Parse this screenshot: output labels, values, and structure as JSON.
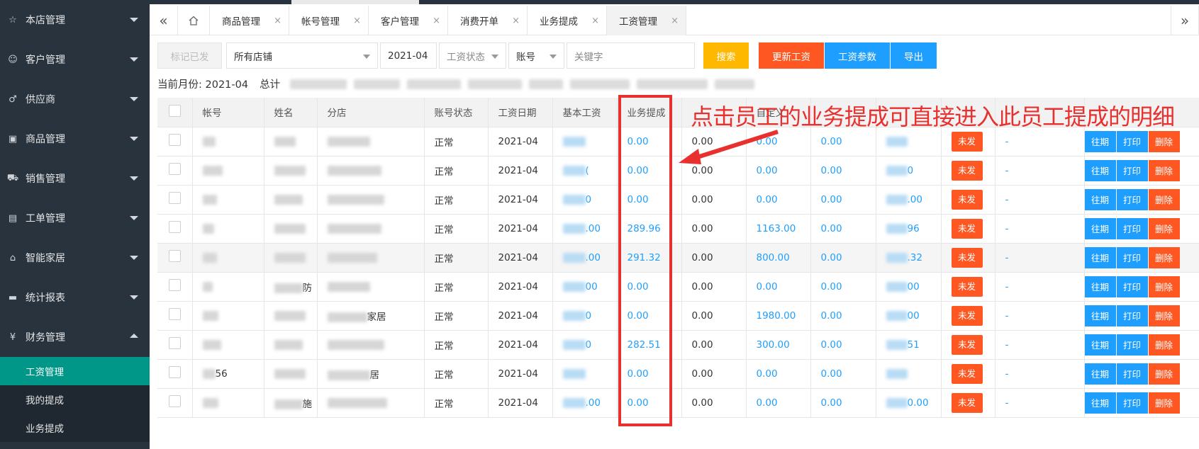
{
  "sidebar": {
    "items": [
      {
        "label": "本店管理",
        "icon": "star-icon"
      },
      {
        "label": "客户管理",
        "icon": "user-icon"
      },
      {
        "label": "供应商",
        "icon": "male-icon"
      },
      {
        "label": "商品管理",
        "icon": "gift-icon"
      },
      {
        "label": "销售管理",
        "icon": "cart-icon"
      },
      {
        "label": "工单管理",
        "icon": "clipboard-icon"
      },
      {
        "label": "智能家居",
        "icon": "home-icon"
      },
      {
        "label": "统计报表",
        "icon": "chart-icon"
      },
      {
        "label": "财务管理",
        "icon": "yen-icon"
      }
    ],
    "sub_items": [
      "工资管理",
      "我的提成",
      "业务提成"
    ],
    "active_sub": "工资管理",
    "active_color": "#009688"
  },
  "tabs": [
    "商品管理",
    "帐号管理",
    "客户管理",
    "消费开单",
    "业务提成",
    "工资管理"
  ],
  "active_tab": "工资管理",
  "toolbar": {
    "mark_paid": "标记已发",
    "store_select": "所有店铺",
    "month": "2021-04",
    "salary_status": "工资状态",
    "account": "账号",
    "keyword_placeholder": "关键字",
    "search": "搜索",
    "update_salary": "更新工资",
    "salary_params": "工资参数",
    "export": "导出",
    "colors": {
      "search": "#ffb800",
      "update": "#ff5722",
      "params": "#1e9fff"
    }
  },
  "summary": {
    "month_label": "当前月份: 2021-04",
    "total_label": "总计"
  },
  "table": {
    "headers": [
      "帐号",
      "姓名",
      "分店",
      "账号状态",
      "工资日期",
      "基本工资",
      "业务提成",
      "",
      "自定义",
      "",
      "",
      "",
      ""
    ],
    "rows": [
      {
        "account": "",
        "name": "",
        "store": "",
        "status": "正常",
        "date": "2021-04",
        "base": "",
        "commission": "0.00",
        "c8": "0.00",
        "custom": "0.00",
        "c10": "0.00",
        "c11": "",
        "c12": "-"
      },
      {
        "account": "",
        "name": "",
        "store": "",
        "status": "正常",
        "date": "2021-04",
        "base": "(",
        "commission": "0.00",
        "c8": "0.00",
        "custom": "0.00",
        "c10": "0.00",
        "c11": "0",
        "c12": "-"
      },
      {
        "account": "",
        "name": "",
        "store": "",
        "status": "正常",
        "date": "2021-04",
        "base": "0",
        "commission": "0.00",
        "c8": "0.00",
        "custom": "0.00",
        "c10": "0.00",
        "c11": ".00",
        "c12": "-"
      },
      {
        "account": "",
        "name": "",
        "store": "",
        "status": "正常",
        "date": "2021-04",
        "base": ".00",
        "commission": "289.96",
        "c8": "0.00",
        "custom": "1163.00",
        "c10": "0.00",
        "c11": "96",
        "c12": "-"
      },
      {
        "account": "",
        "name": "",
        "store": "",
        "status": "正常",
        "date": "2021-04",
        "base": ".00",
        "commission": "291.32",
        "c8": "0.00",
        "custom": "800.00",
        "c10": "0.00",
        "c11": ".32",
        "c12": "-"
      },
      {
        "account": "",
        "name": "防",
        "store": "",
        "status": "正常",
        "date": "2021-04",
        "base": "00",
        "commission": "0.00",
        "c8": "0.00",
        "custom": "0.00",
        "c10": "0.00",
        "c11": "00",
        "c12": "-"
      },
      {
        "account": "",
        "name": "",
        "store": "家居",
        "status": "正常",
        "date": "2021-04",
        "base": "0",
        "commission": "0.00",
        "c8": "0.00",
        "custom": "1980.00",
        "c10": "0.00",
        "c11": "00",
        "c12": "-"
      },
      {
        "account": "",
        "name": "",
        "store": "",
        "status": "正常",
        "date": "2021-04",
        "base": "0",
        "commission": "282.51",
        "c8": "0.00",
        "custom": "300.00",
        "c10": "0.00",
        "c11": "51",
        "c12": "-"
      },
      {
        "account": "56",
        "name": "",
        "store": "居",
        "status": "正常",
        "date": "2021-04",
        "base": "",
        "commission": "0.00",
        "c8": "0.00",
        "custom": "0.00",
        "c10": "0.00",
        "c11": "",
        "c12": "-"
      },
      {
        "account": "",
        "name": "施",
        "store": "",
        "status": "正常",
        "date": "2021-04",
        "base": ".00",
        "commission": "0.00",
        "c8": "0.00",
        "custom": "0.00",
        "c10": "0.00",
        "c11": "0.00",
        "c12": "-"
      }
    ],
    "unpaid_label": "未发",
    "actions": {
      "history": "往期",
      "print": "打印",
      "delete": "删除"
    }
  },
  "annotation": {
    "text": "点击员工的业务提成可直接进入此员工提成的明细",
    "color": "#e8312f"
  }
}
